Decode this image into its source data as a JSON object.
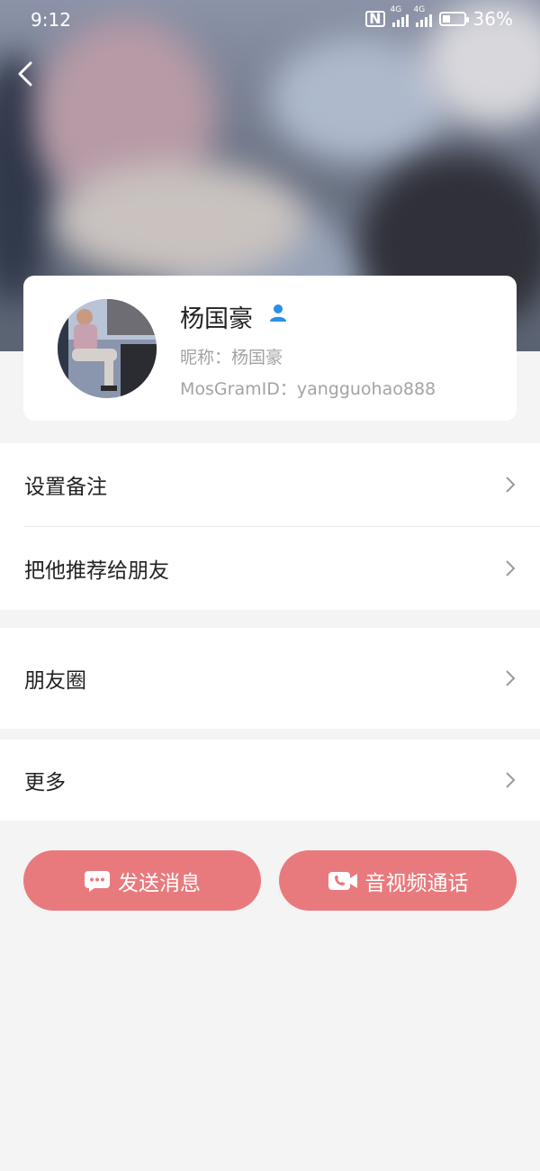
{
  "status_bar": {
    "time": "9:12",
    "nfc": "N",
    "signal1_label": "4G",
    "signal2_label": "4G",
    "battery": "36%",
    "battery_level": 0.36
  },
  "header": {
    "back_icon": "chevron-left-icon"
  },
  "profile": {
    "name": "杨国豪",
    "nickname": "昵称：杨国豪",
    "mosgram_id": "MosGramID：yangguohao888",
    "user_icon_color": "#2a8fe6"
  },
  "menu": {
    "section1": [
      {
        "label": "设置备注"
      },
      {
        "label": "把他推荐给朋友"
      }
    ],
    "section2": [
      {
        "label": "朋友圈"
      }
    ],
    "section3": [
      {
        "label": "更多"
      }
    ]
  },
  "actions": {
    "send_message": "发送消息",
    "av_call": "音视频通话",
    "button_color": "#e87a7d"
  }
}
